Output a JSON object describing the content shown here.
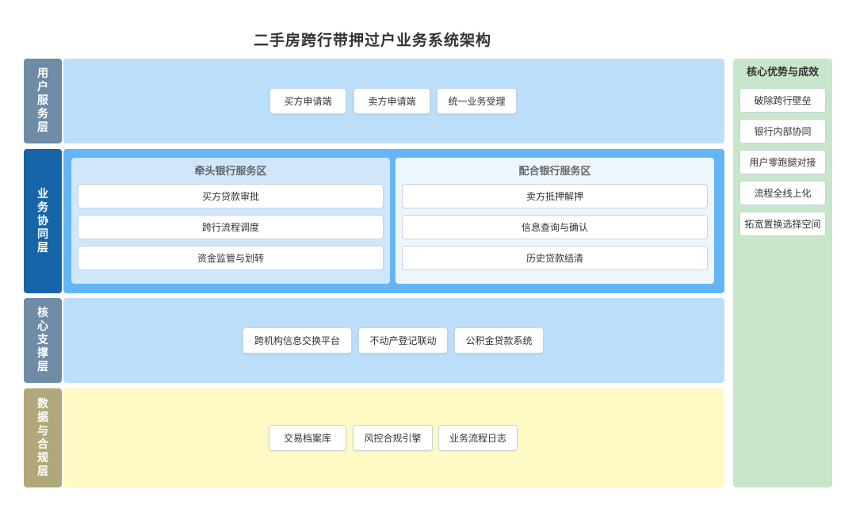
{
  "title": "二手房跨行带押过户业务系统架构",
  "layers": {
    "user": {
      "label": "用户服务层",
      "color": "#6e8ca6",
      "bg": "#bbdefb",
      "items": [
        "买方申请端",
        "卖方申请端",
        "统一业务受理"
      ]
    },
    "business": {
      "label": "业务协同层",
      "color": "#1565a8",
      "bg": "#64b5f6",
      "lead_zone": {
        "title": "牵头银行服务区",
        "items": [
          "买方贷款审批",
          "跨行流程调度",
          "资金监管与划转"
        ]
      },
      "partner_zone": {
        "title": "配合银行服务区",
        "items": [
          "卖方抵押解押",
          "信息查询与确认",
          "历史贷款结清"
        ]
      }
    },
    "core": {
      "label": "核心支撑层",
      "color": "#6e8ca6",
      "bg": "#bbdefb",
      "items": [
        "跨机构信息交换平台",
        "不动产登记联动",
        "公积金贷款系统"
      ]
    },
    "data": {
      "label": "数据与合规层",
      "color": "#b0a878",
      "bg": "#fff9c4",
      "items": [
        "交易档案库",
        "风控合规引擎",
        "业务流程日志"
      ]
    }
  },
  "advantages": {
    "title": "核心优势与成效",
    "items": [
      "破除跨行壁垒",
      "银行内部协同",
      "用户零跑腿对接",
      "流程全线上化",
      "拓宽置换选择空间"
    ]
  }
}
